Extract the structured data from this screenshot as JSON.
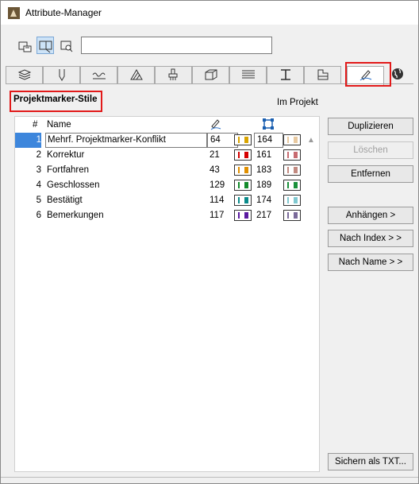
{
  "window": {
    "title": "Attribute-Manager"
  },
  "search": {
    "value": "",
    "placeholder": ""
  },
  "panel": {
    "title": "Projektmarker-Stile",
    "in_project_label": "Im Projekt"
  },
  "list": {
    "columns": {
      "num": "#",
      "name": "Name"
    },
    "rows": [
      {
        "num": "1",
        "name": "Mehrf. Projektmarker-Konflikt",
        "val1": "64",
        "val2": "164",
        "color": "#d9a400",
        "color2": "#e8c9a0",
        "selected": true
      },
      {
        "num": "2",
        "name": "Korrektur",
        "val1": "21",
        "val2": "161",
        "color": "#d40000",
        "color2": "#c76b70",
        "selected": false
      },
      {
        "num": "3",
        "name": "Fortfahren",
        "val1": "43",
        "val2": "183",
        "color": "#e08f00",
        "color2": "#c28a80",
        "selected": false
      },
      {
        "num": "4",
        "name": "Geschlossen",
        "val1": "129",
        "val2": "189",
        "color": "#128a2a",
        "color2": "#1a8f3a",
        "selected": false
      },
      {
        "num": "5",
        "name": "Bestätigt",
        "val1": "114",
        "val2": "174",
        "color": "#0a8a8a",
        "color2": "#80c8d0",
        "selected": false
      },
      {
        "num": "6",
        "name": "Bemerkungen",
        "val1": "117",
        "val2": "217",
        "color": "#5a1aa0",
        "color2": "#7a6a9a",
        "selected": false
      }
    ]
  },
  "buttons": {
    "duplicate": "Duplizieren",
    "delete": "Löschen",
    "remove": "Entfernen",
    "append": "Anhängen >",
    "by_index": "Nach Index > >",
    "by_name": "Nach Name > >",
    "save_txt": "Sichern als TXT..."
  },
  "tabs": [
    "layers-icon",
    "pen-icon",
    "line-type-icon",
    "fill-icon",
    "surface-icon",
    "building-material-icon",
    "zone-icon",
    "profile-icon",
    "composite-icon",
    "markup-style-icon",
    "globe-icon"
  ],
  "colors": {
    "accent": "#3d86dc",
    "highlight": "#e21a1a"
  }
}
